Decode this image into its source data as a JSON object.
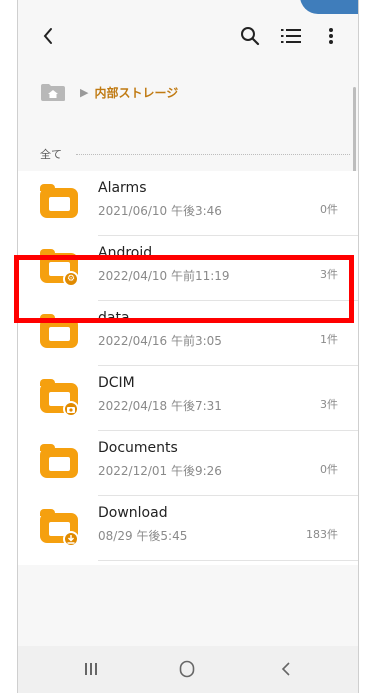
{
  "toolbar": {
    "back": "back-icon",
    "search": "search-icon",
    "list_view": "list-view-icon",
    "more": "more-vert-icon"
  },
  "breadcrumb": {
    "home": "home-folder-icon",
    "label": "内部ストレージ"
  },
  "section": {
    "label": "全て"
  },
  "files": [
    {
      "name": "Alarms",
      "date": "2021/06/10 午後3:46",
      "count": "0件",
      "badge": null
    },
    {
      "name": "Android",
      "date": "2022/04/10 午前11:19",
      "count": "3件",
      "badge": "gear"
    },
    {
      "name": "data",
      "date": "2022/04/16 午前3:05",
      "count": "1件",
      "badge": null
    },
    {
      "name": "DCIM",
      "date": "2022/04/18 午後7:31",
      "count": "3件",
      "badge": "camera"
    },
    {
      "name": "Documents",
      "date": "2022/12/01 午後9:26",
      "count": "0件",
      "badge": null,
      "highlighted": true
    },
    {
      "name": "Download",
      "date": "08/29 午後5:45",
      "count": "183件",
      "badge": "download"
    }
  ],
  "navbar": {
    "recent": "recent-apps-icon",
    "home": "home-icon",
    "back": "nav-back-icon"
  },
  "colors": {
    "folder": "#f5a00f",
    "crumb": "#c07a12",
    "highlight": "#ff0000"
  }
}
